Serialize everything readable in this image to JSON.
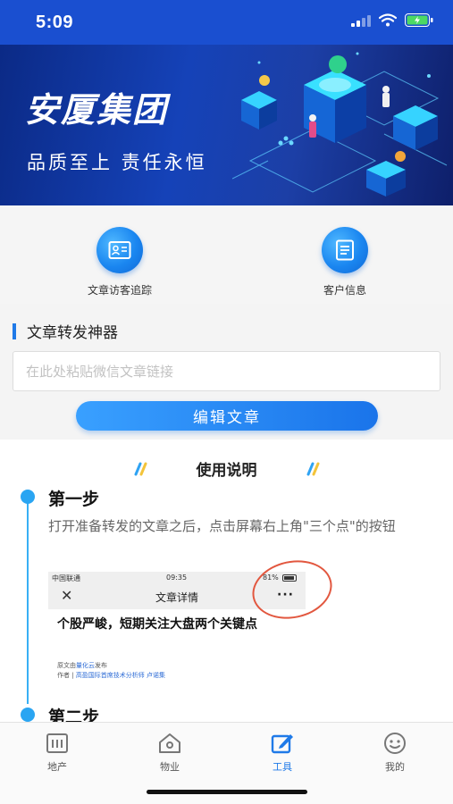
{
  "status_bar": {
    "time": "5:09"
  },
  "banner": {
    "title": "安厦集团",
    "slogan": "品质至上 责任永恒"
  },
  "quick_actions": [
    {
      "label": "文章访客追踪",
      "icon": "id-card-icon"
    },
    {
      "label": "客户信息",
      "icon": "document-list-icon"
    }
  ],
  "forward_tool": {
    "title": "文章转发神器",
    "input_placeholder": "在此处粘贴微信文章链接",
    "input_value": "",
    "button_label": "编辑文章"
  },
  "guide": {
    "title": "使用说明",
    "steps": [
      {
        "title": "第一步",
        "description": "打开准备转发的文章之后，点击屏幕右上角\"三个点\"的按钮"
      },
      {
        "title": "第二步"
      }
    ],
    "example_screenshot": {
      "carrier": "中国联通",
      "time": "09:35",
      "battery": "81%",
      "close": "✕",
      "nav_title": "文章详情",
      "more": "···",
      "headline": "个股严峻，短期关注大盘两个关键点",
      "source_prefix": "原文由",
      "source_name": "量化云",
      "source_suffix": "发布",
      "author_prefix": "作者 | ",
      "author_name": "高盈国际首席技术分析师 卢诺集"
    }
  },
  "tabbar": {
    "active": "工具",
    "items": [
      {
        "label": "地产",
        "icon": "building-icon"
      },
      {
        "label": "物业",
        "icon": "house-icon"
      },
      {
        "label": "工具",
        "icon": "edit-icon"
      },
      {
        "label": "我的",
        "icon": "smiley-icon"
      }
    ]
  },
  "colors": {
    "brand_blue": "#1f7ae8",
    "banner_blue": "#1a4fd0",
    "highlight_red": "#e2573f"
  }
}
